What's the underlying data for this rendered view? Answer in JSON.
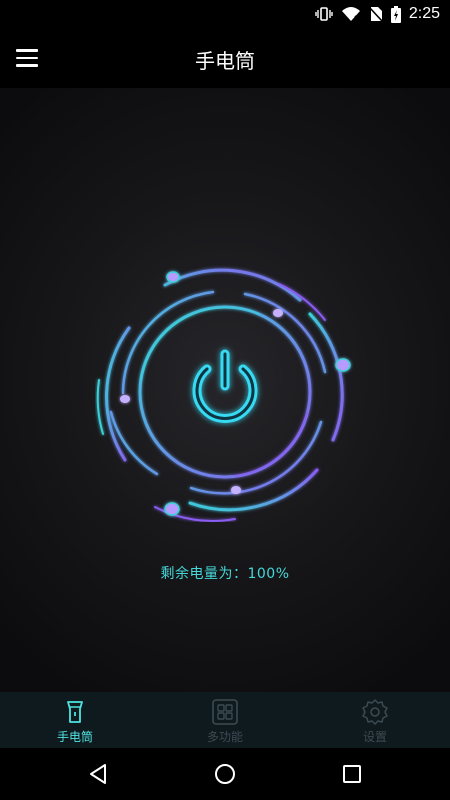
{
  "status_bar": {
    "time": "2:25"
  },
  "app_bar": {
    "title": "手电筒"
  },
  "main": {
    "battery_text": "剩余电量为：100%"
  },
  "bottom_nav": {
    "items": [
      {
        "label": "手电筒",
        "icon": "flashlight-icon",
        "active": true
      },
      {
        "label": "多功能",
        "icon": "grid-icon",
        "active": false
      },
      {
        "label": "设置",
        "icon": "gear-icon",
        "active": false
      }
    ]
  },
  "colors": {
    "accent_cyan": "#45d7d8",
    "ring_purple": "#8a5cf0",
    "nav_background": "#0f1a1f"
  }
}
